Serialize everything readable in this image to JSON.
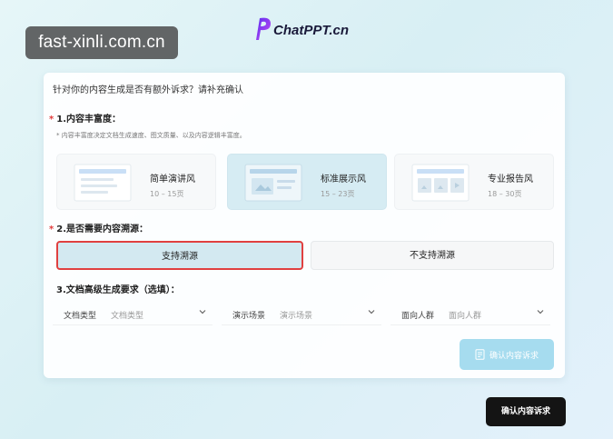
{
  "watermark": "fast-xinli.com.cn",
  "logo": {
    "text": "ChatPPT.cn"
  },
  "question_title": "针对你的内容生成是否有额外诉求？请补充确认",
  "section1": {
    "label": "1.内容丰富度：",
    "hint": "* 内容丰富度决定文档生成速度、图文质量、以及内容逻辑丰富度。",
    "options": [
      {
        "name": "简单演讲风",
        "range": "10 – 15页",
        "selected": false
      },
      {
        "name": "标准展示风",
        "range": "15 – 23页",
        "selected": true
      },
      {
        "name": "专业报告风",
        "range": "18 – 30页",
        "selected": false
      }
    ]
  },
  "section2": {
    "label": "2.是否需要内容溯源：",
    "options": [
      {
        "label": "支持溯源",
        "selected": true
      },
      {
        "label": "不支持溯源",
        "selected": false
      }
    ]
  },
  "section3": {
    "label": "3.文档高级生成要求（选填）：",
    "selects": [
      {
        "label": "文档类型",
        "placeholder": "文档类型"
      },
      {
        "label": "演示场景",
        "placeholder": "演示场景"
      },
      {
        "label": "面向人群",
        "placeholder": "面向人群"
      }
    ]
  },
  "buttons": {
    "confirm_inner": "确认内容诉求",
    "confirm_main": "确认内容诉求"
  },
  "colors": {
    "accent": "#a6dcef",
    "selected_bg": "#d6ecf3",
    "required": "#e23b3b",
    "highlight_border": "#e04040",
    "logo_purple": "#7b2ff7"
  }
}
